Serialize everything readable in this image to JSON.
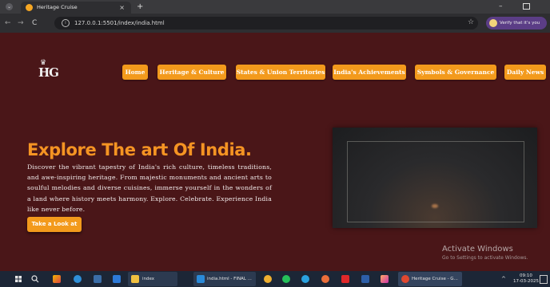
{
  "browser": {
    "tab_title": "Heritage Cruise",
    "tab_close": "×",
    "new_tab": "+",
    "url": "127.0.0.1:5501/index/india.html",
    "verify_label": "Verify that it's you",
    "minimize_glyph": "–",
    "back_glyph": "←",
    "forward_glyph": "→",
    "reload_glyph": "C",
    "site_info_glyph": "i",
    "bookmark_glyph": "☆",
    "menu_glyph": "⌄"
  },
  "site": {
    "logo_text": "HG",
    "logo_crown": "♛",
    "nav": [
      {
        "label": "Home"
      },
      {
        "label": "Heritage & Culture"
      },
      {
        "label": "States & Union Territories"
      },
      {
        "label": "India's Achievements"
      },
      {
        "label": "Symbols & Governance"
      },
      {
        "label": "Daily News"
      }
    ],
    "hero_title": "Explore The art Of India.",
    "hero_text": "Discover the vibrant tapestry of India's rich culture, timeless traditions, and awe-inspiring heritage. From majestic monuments and ancient arts to soulful melodies and diverse cuisines, immerse yourself in the wonders of a land where history meets harmony. Explore. Celebrate. Experience India like never before.",
    "cta_label": "Take a Look at"
  },
  "watermark": {
    "title": "Activate Windows",
    "subtitle": "Go to Settings to activate Windows."
  },
  "taskbar": {
    "items": [
      {
        "label": "index"
      },
      {
        "label": "india.html - FINAL ..."
      },
      {
        "label": "Heritage Cruise - G..."
      }
    ],
    "time": "09:10",
    "date": "17-03-2025",
    "tray_up": "^"
  },
  "colors": {
    "page_bg": "#4a1618",
    "accent": "#f39a1c",
    "title": "#f59423"
  }
}
